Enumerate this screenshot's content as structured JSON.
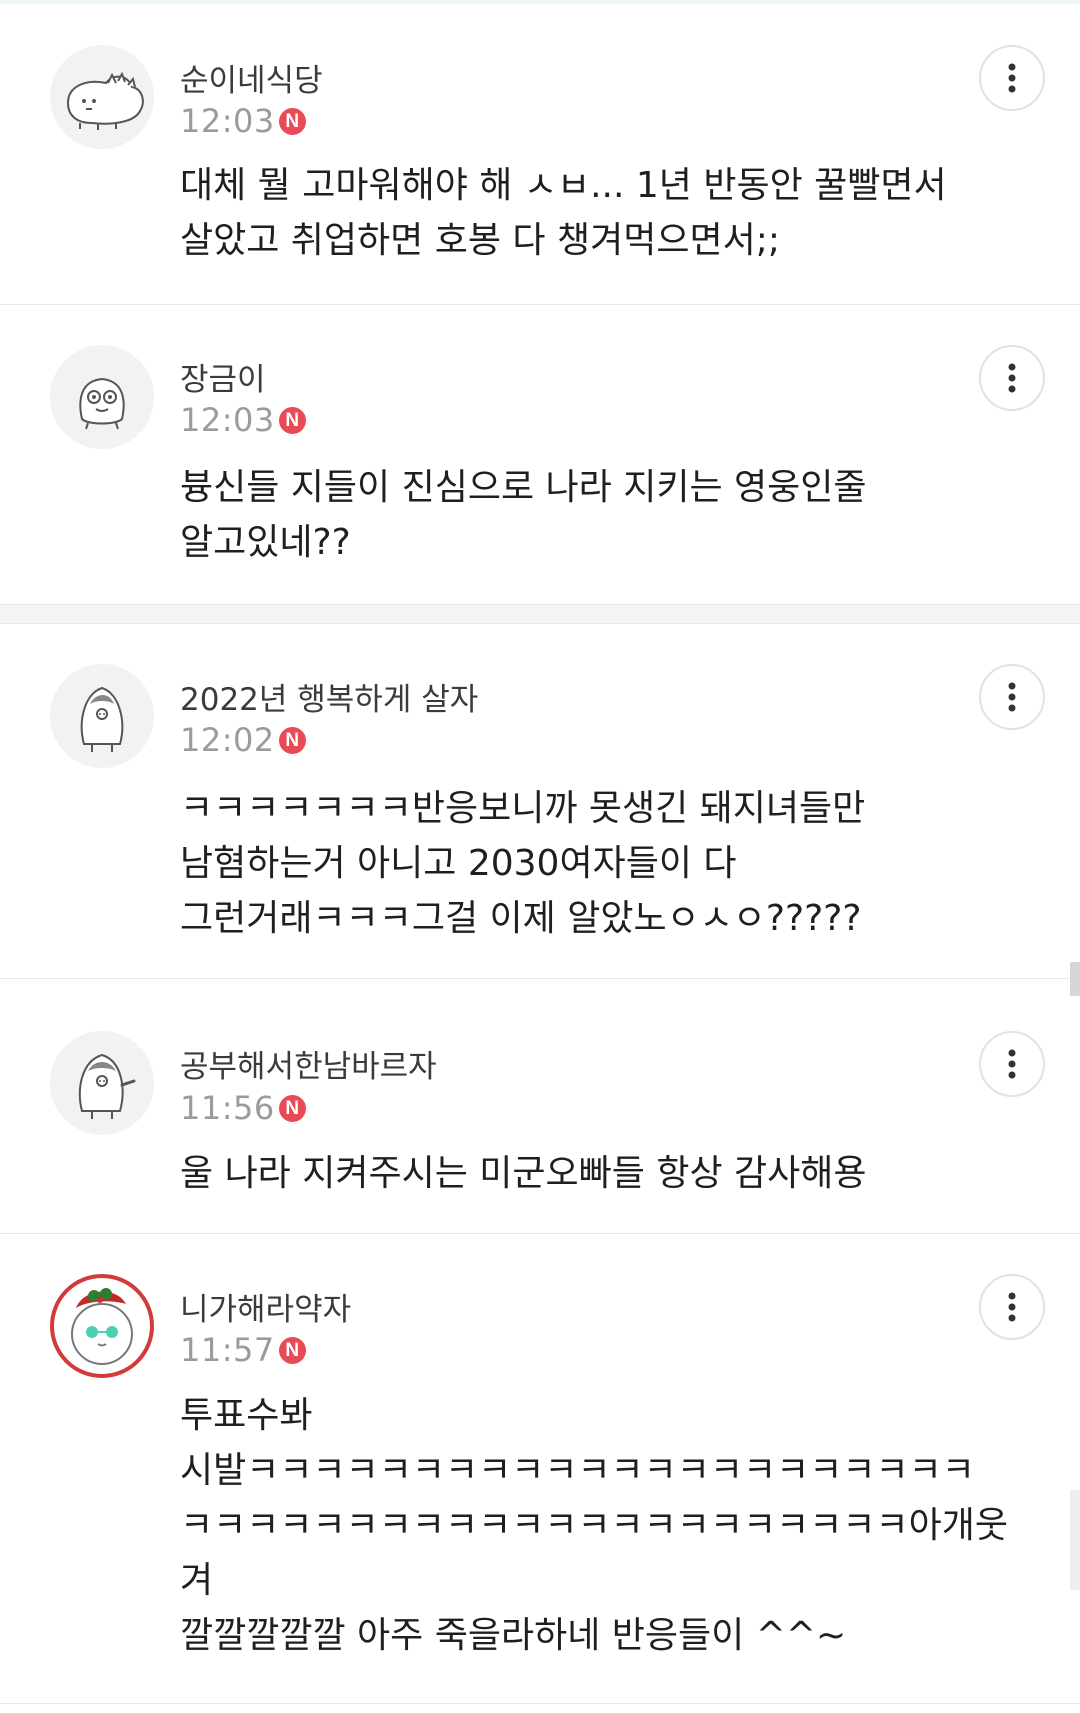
{
  "comments": [
    {
      "author": "순이네식당",
      "time": "12:03",
      "badge": "N",
      "text": "대체 뭘 고마워해야 해 ㅅㅂ... 1년 반동안 꿀빨면서\n살았고 취업하면 호봉 다 챙겨먹으면서;;",
      "avatar_icon": "dinosaur-character-icon"
    },
    {
      "author": "장금이",
      "time": "12:03",
      "badge": "N",
      "text": "븅신들 지들이 진심으로 나라 지키는 영웅인줄\n알고있네??",
      "avatar_icon": "ghost-character-icon"
    },
    {
      "author": "2022년 행복하게 살자",
      "time": "12:02",
      "badge": "N",
      "text": "ㅋㅋㅋㅋㅋㅋㅋ반응보니까 못생긴 돼지녀들만\n남혐하는거 아니고 2030여자들이 다\n그런거래ㅋㅋㅋ그걸 이제 알았노ㅇㅅㅇ?????",
      "avatar_icon": "penguin-character-icon"
    },
    {
      "author": "공부해서한남바르자",
      "time": "11:56",
      "badge": "N",
      "text": "울 나라 지켜주시는 미군오빠들 항상 감사해용",
      "avatar_icon": "penguin-waving-character-icon"
    },
    {
      "author": "니가해라약자",
      "time": "11:57",
      "badge": "N",
      "text": "투표수봐\n시발ㅋㅋㅋㅋㅋㅋㅋㅋㅋㅋㅋㅋㅋㅋㅋㅋㅋㅋㅋㅋㅋㅋ\nㅋㅋㅋㅋㅋㅋㅋㅋㅋㅋㅋㅋㅋㅋㅋㅋㅋㅋㅋㅋㅋㅋ아개웃\n겨\n깔깔깔깔깔 아주 죽을라하네 반응들이 ^^~",
      "avatar_icon": "christmas-character-icon"
    }
  ],
  "more_icon": "more-vertical-icon",
  "colors": {
    "badge": "#e84b55",
    "time": "#9b9b9b",
    "author": "#3b3b3b",
    "body": "#1f1f1f",
    "divider": "#e9e9e9"
  }
}
